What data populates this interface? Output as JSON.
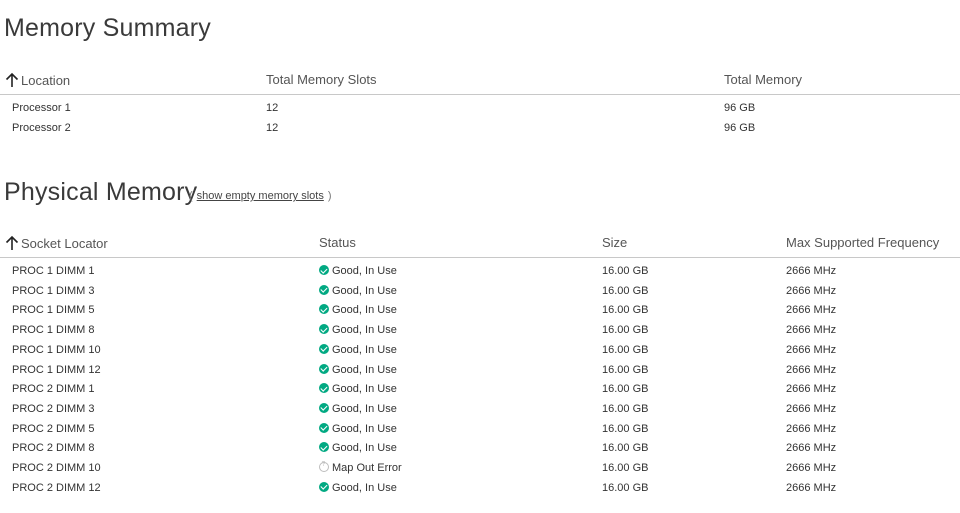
{
  "memory_summary": {
    "title": "Memory Summary",
    "columns": {
      "location": "Location",
      "total_slots": "Total Memory Slots",
      "total_memory": "Total Memory"
    },
    "rows": [
      {
        "location": "Processor 1",
        "slots": "12",
        "memory": "96 GB"
      },
      {
        "location": "Processor 2",
        "slots": "12",
        "memory": "96 GB"
      }
    ]
  },
  "physical_memory": {
    "title": "Physical Memory",
    "paren_open": "(",
    "paren_close": ")",
    "show_empty_link": "show empty memory slots",
    "columns": {
      "socket": "Socket Locator",
      "status": "Status",
      "size": "Size",
      "freq": "Max Supported Frequency"
    },
    "rows": [
      {
        "socket": "PROC 1 DIMM 1",
        "status": "Good, In Use",
        "status_icon": "ok-check-icon",
        "size": "16.00 GB",
        "freq": "2666 MHz"
      },
      {
        "socket": "PROC 1 DIMM 3",
        "status": "Good, In Use",
        "status_icon": "ok-check-icon",
        "size": "16.00 GB",
        "freq": "2666 MHz"
      },
      {
        "socket": "PROC 1 DIMM 5",
        "status": "Good, In Use",
        "status_icon": "ok-check-icon",
        "size": "16.00 GB",
        "freq": "2666 MHz"
      },
      {
        "socket": "PROC 1 DIMM 8",
        "status": "Good, In Use",
        "status_icon": "ok-check-icon",
        "size": "16.00 GB",
        "freq": "2666 MHz"
      },
      {
        "socket": "PROC 1 DIMM 10",
        "status": "Good, In Use",
        "status_icon": "ok-check-icon",
        "size": "16.00 GB",
        "freq": "2666 MHz"
      },
      {
        "socket": "PROC 1 DIMM 12",
        "status": "Good, In Use",
        "status_icon": "ok-check-icon",
        "size": "16.00 GB",
        "freq": "2666 MHz"
      },
      {
        "socket": "PROC 2 DIMM 1",
        "status": "Good, In Use",
        "status_icon": "ok-check-icon",
        "size": "16.00 GB",
        "freq": "2666 MHz"
      },
      {
        "socket": "PROC 2 DIMM 3",
        "status": "Good, In Use",
        "status_icon": "ok-check-icon",
        "size": "16.00 GB",
        "freq": "2666 MHz"
      },
      {
        "socket": "PROC 2 DIMM 5",
        "status": "Good, In Use",
        "status_icon": "ok-check-icon",
        "size": "16.00 GB",
        "freq": "2666 MHz"
      },
      {
        "socket": "PROC 2 DIMM 8",
        "status": "Good, In Use",
        "status_icon": "ok-check-icon",
        "size": "16.00 GB",
        "freq": "2666 MHz"
      },
      {
        "socket": "PROC 2 DIMM 10",
        "status": "Map Out Error",
        "status_icon": "unknown-status-icon",
        "size": "16.00 GB",
        "freq": "2666 MHz"
      },
      {
        "socket": "PROC 2 DIMM 12",
        "status": "Good, In Use",
        "status_icon": "ok-check-icon",
        "size": "16.00 GB",
        "freq": "2666 MHz"
      }
    ]
  },
  "colors": {
    "ok_status": "#01a982",
    "unknown_status": "#bdbdbd",
    "divider": "#c8c8c8"
  }
}
